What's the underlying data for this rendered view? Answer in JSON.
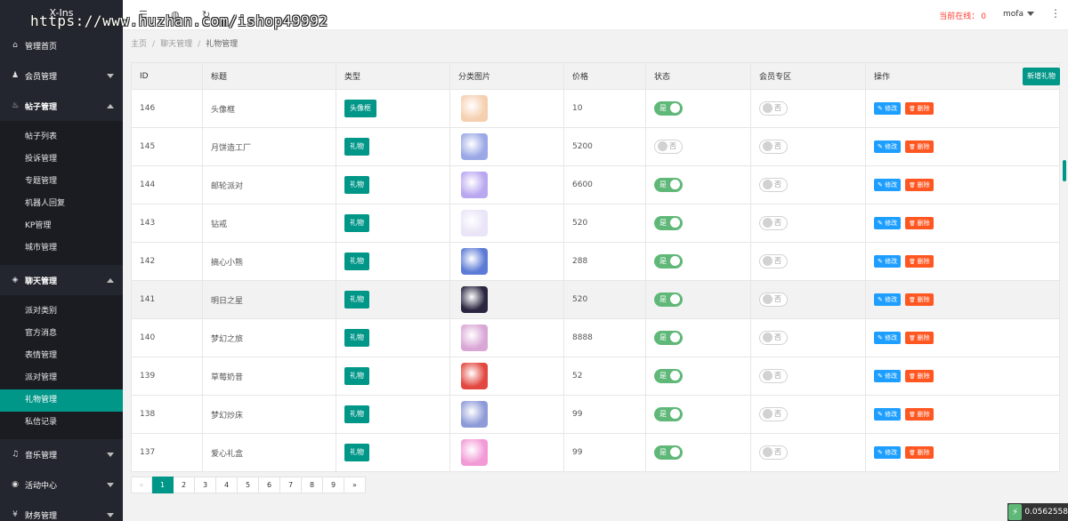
{
  "watermark": "https://www.huzhan.com/ishop49992",
  "sidebar": {
    "logo": "X-Ins",
    "groups": [
      {
        "label": "管理首页",
        "icon": "home-icon",
        "glyph": "⌂",
        "arrow": "none"
      },
      {
        "label": "会员管理",
        "icon": "user-icon",
        "glyph": "♟",
        "arrow": "down"
      },
      {
        "label": "帖子管理",
        "icon": "fire-icon",
        "glyph": "♨",
        "arrow": "up",
        "children": [
          "帖子列表",
          "投诉管理",
          "专题管理",
          "机器人回复",
          "KP管理",
          "城市管理"
        ]
      },
      {
        "label": "聊天管理",
        "icon": "voice-icon",
        "glyph": "◈",
        "arrow": "up",
        "children": [
          "派对类别",
          "官方消息",
          "表情管理",
          "派对管理",
          "礼物管理",
          "私信记录"
        ],
        "active_child": 4
      },
      {
        "label": "音乐管理",
        "icon": "music-icon",
        "glyph": "♫",
        "arrow": "down"
      },
      {
        "label": "活动中心",
        "icon": "compass-icon",
        "glyph": "◉",
        "arrow": "down"
      },
      {
        "label": "财务管理",
        "icon": "coin-icon",
        "glyph": "¥",
        "arrow": "down"
      }
    ]
  },
  "header": {
    "online_label": "当前在线：",
    "online_count": "0",
    "username": "mofa"
  },
  "breadcrumb": [
    "主页",
    "聊天管理",
    "礼物管理"
  ],
  "table": {
    "add_button": "新增礼物",
    "columns": [
      "ID",
      "标题",
      "类型",
      "分类图片",
      "价格",
      "状态",
      "会员专区",
      "操作"
    ],
    "edit_label": "修改",
    "delete_label": "删除",
    "on_label": "是",
    "off_label": "否",
    "rows": [
      {
        "id": "146",
        "title": "头像框",
        "type": "头像框",
        "price": "10",
        "status": true,
        "vip": false,
        "thumb": "#f5d0b0",
        "highlight": false
      },
      {
        "id": "145",
        "title": "月饼造工厂",
        "type": "礼物",
        "price": "5200",
        "status": false,
        "vip": false,
        "thumb": "#9aa8e6",
        "highlight": false
      },
      {
        "id": "144",
        "title": "邮轮派对",
        "type": "礼物",
        "price": "6600",
        "status": true,
        "vip": false,
        "thumb": "#b9a7f0",
        "highlight": false
      },
      {
        "id": "143",
        "title": "钻戒",
        "type": "礼物",
        "price": "520",
        "status": true,
        "vip": false,
        "thumb": "#e9e4f7",
        "highlight": false
      },
      {
        "id": "142",
        "title": "摘心小熊",
        "type": "礼物",
        "price": "288",
        "status": true,
        "vip": false,
        "thumb": "#5d7bd6",
        "highlight": false
      },
      {
        "id": "141",
        "title": "明日之星",
        "type": "礼物",
        "price": "520",
        "status": true,
        "vip": false,
        "thumb": "#2b2540",
        "highlight": true
      },
      {
        "id": "140",
        "title": "梦幻之旅",
        "type": "礼物",
        "price": "8888",
        "status": true,
        "vip": false,
        "thumb": "#d9a7d6",
        "highlight": false
      },
      {
        "id": "139",
        "title": "草莓奶昔",
        "type": "礼物",
        "price": "52",
        "status": true,
        "vip": false,
        "thumb": "#e2483f",
        "highlight": false
      },
      {
        "id": "138",
        "title": "梦幻炒床",
        "type": "礼物",
        "price": "99",
        "status": true,
        "vip": false,
        "thumb": "#8e9bd8",
        "highlight": false
      },
      {
        "id": "137",
        "title": "爱心礼盒",
        "type": "礼物",
        "price": "99",
        "status": true,
        "vip": false,
        "thumb": "#f29ad6",
        "highlight": false
      }
    ]
  },
  "pagination": {
    "prev": "«",
    "pages": [
      "1",
      "2",
      "3",
      "4",
      "5",
      "6",
      "7",
      "8",
      "9"
    ],
    "next": "»",
    "current": "1"
  },
  "speed_badge": "0.0562558"
}
